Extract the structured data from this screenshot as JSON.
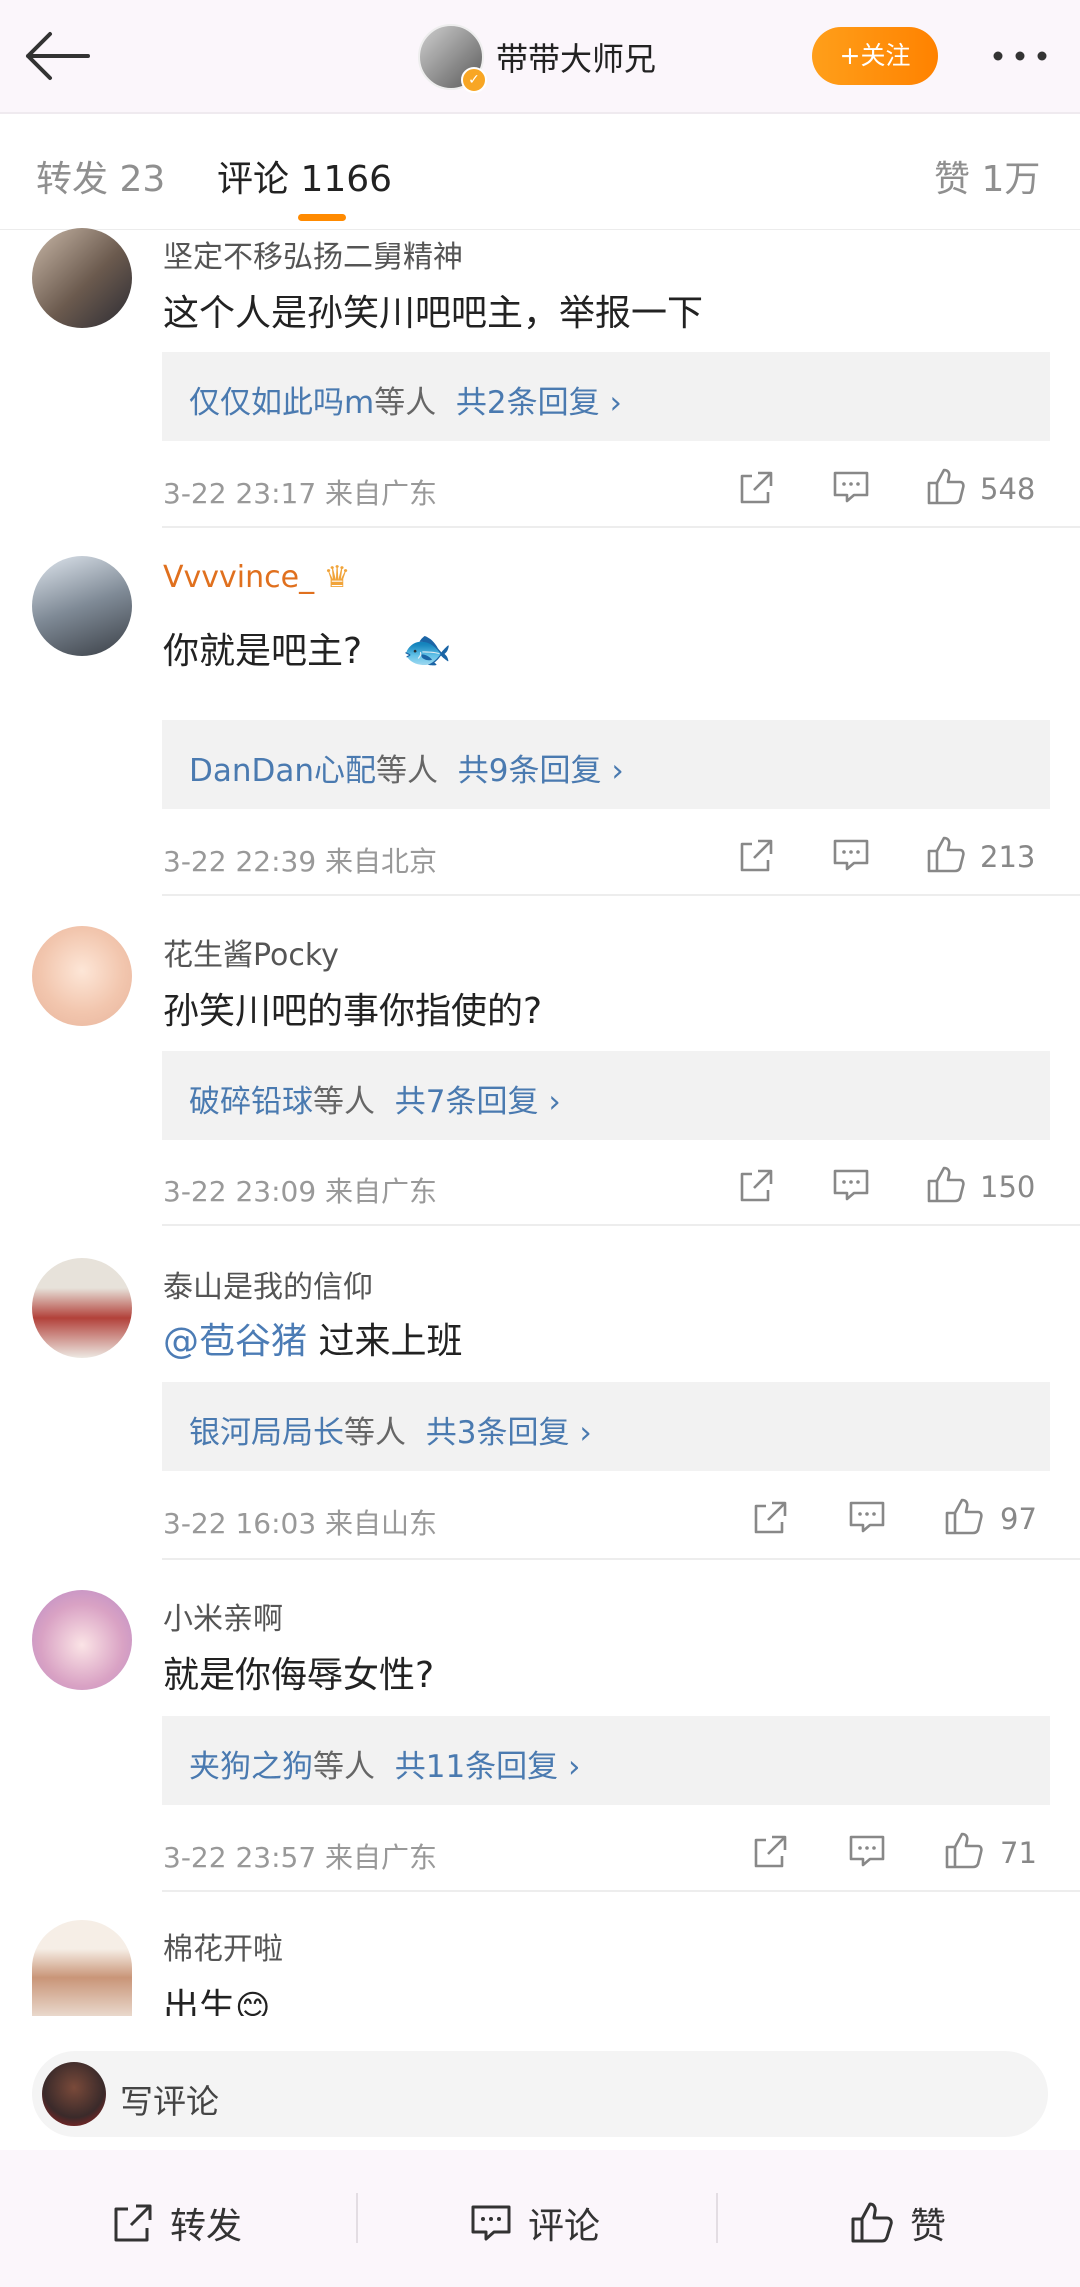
{
  "header": {
    "username": "带带大师兄",
    "follow_label": "+关注"
  },
  "tabs": {
    "forward": "转发 23",
    "comment": "评论 1166",
    "like": "赞 1万"
  },
  "comments": [
    {
      "name": "坚定不移弘扬二舅精神",
      "text": "这个人是孙笑川吧吧主，举报一下",
      "replies_who": "仅仅如此吗m",
      "replies_suffix": "等人",
      "replies_count": "共2条回复",
      "meta": "3-22 23:17  来自广东",
      "likes": "548"
    },
    {
      "name": "Vvvvince_",
      "text": "你就是吧主?",
      "replies_who": "DanDan心配",
      "replies_suffix": "等人",
      "replies_count": "共9条回复",
      "meta": "3-22 22:39  来自北京",
      "likes": "213"
    },
    {
      "name": "花生酱Pocky",
      "text": "孙笑川吧的事你指使的?",
      "replies_who": "破碎铅球",
      "replies_suffix": "等人",
      "replies_count": "共7条回复",
      "meta": "3-22 23:09  来自广东",
      "likes": "150"
    },
    {
      "name": "泰山是我的信仰",
      "text_mention": "@苞谷猪",
      "text": " 过来上班",
      "replies_who": "银河局局长",
      "replies_suffix": "等人",
      "replies_count": "共3条回复",
      "meta": "3-22 16:03  来自山东",
      "likes": "97"
    },
    {
      "name": "小米亲啊",
      "text": "就是你侮辱女性?",
      "replies_who": "夹狗之狗",
      "replies_suffix": "等人",
      "replies_count": "共11条回复",
      "meta": "3-22 23:57  来自广东",
      "likes": "71"
    },
    {
      "name": "棉花开啦",
      "text": "出生"
    }
  ],
  "composer": {
    "placeholder": "写评论"
  },
  "bottom_bar": {
    "forward": "转发",
    "comment": "评论",
    "like": "赞"
  }
}
